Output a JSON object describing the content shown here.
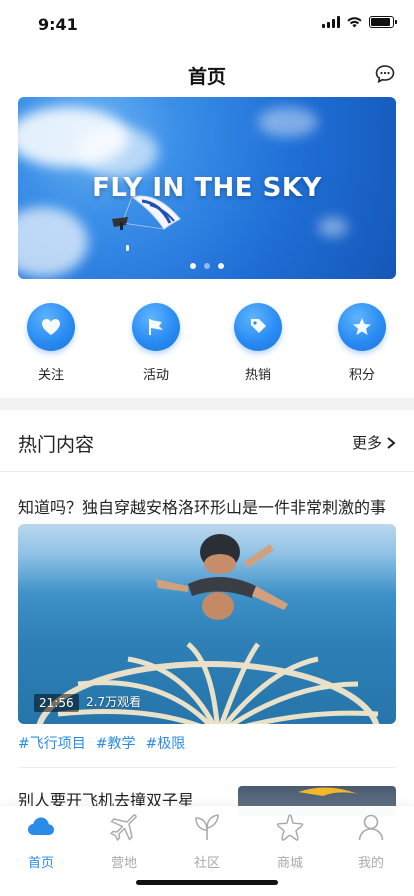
{
  "status_bar": {
    "time": "9:41"
  },
  "nav": {
    "title": "首页",
    "chat_icon": "chat-bubble-icon"
  },
  "banner": {
    "headline": "FLY IN THE SKY",
    "slide_count": 3,
    "active_slide": 1
  },
  "quick_menu": [
    {
      "label": "关注",
      "icon": "heart-icon"
    },
    {
      "label": "活动",
      "icon": "flag-icon"
    },
    {
      "label": "热销",
      "icon": "price-tag-icon"
    },
    {
      "label": "积分",
      "icon": "star-icon"
    }
  ],
  "hot_section": {
    "title": "热门内容",
    "more_label": "更多"
  },
  "articles": [
    {
      "title": "知道吗？独自穿越安格洛环形山是一件非常刺激的事",
      "duration": "21:56",
      "views": "2.7万观看",
      "tags": [
        "#飞行项目",
        "#教学",
        "#极限"
      ]
    },
    {
      "title": "别人要开飞机去撞双子星"
    }
  ],
  "tab_bar": {
    "items": [
      {
        "label": "首页",
        "icon": "cloud-icon",
        "active": true
      },
      {
        "label": "营地",
        "icon": "airplane-icon",
        "active": false
      },
      {
        "label": "社区",
        "icon": "sprout-icon",
        "active": false
      },
      {
        "label": "商城",
        "icon": "starfish-icon",
        "active": false
      },
      {
        "label": "我的",
        "icon": "person-icon",
        "active": false
      }
    ]
  },
  "colors": {
    "accent": "#2a8ce8",
    "inactive": "#aaaaaa"
  }
}
